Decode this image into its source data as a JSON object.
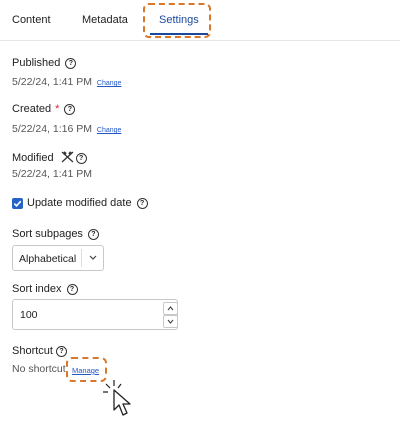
{
  "tabs": {
    "content": "Content",
    "metadata": "Metadata",
    "settings": "Settings"
  },
  "published": {
    "label": "Published",
    "value": "5/22/24, 1:41 PM",
    "action": "Change"
  },
  "created": {
    "label": "Created",
    "required_mark": "*",
    "value": "5/22/24, 1:16 PM",
    "action": "Change"
  },
  "modified": {
    "label": "Modified",
    "value": "5/22/24, 1:41 PM"
  },
  "update_modified": {
    "label": "Update modified date",
    "checked": true
  },
  "sort_subpages": {
    "label": "Sort subpages",
    "selected": "Alphabetical"
  },
  "sort_index": {
    "label": "Sort index",
    "value": "100"
  },
  "shortcut": {
    "label": "Shortcut",
    "value": "No shortcut",
    "action": "Manage"
  },
  "colors": {
    "accent": "#1a4a9e",
    "link": "#2458c8",
    "checkbox": "#2563c7",
    "highlight": "#d9782b",
    "required": "#dd2233"
  },
  "icons": {
    "help": "help-circle-icon",
    "modified_disabled": "tools-crossed-icon",
    "checkbox": "check-icon",
    "select": "chevron-down-icon",
    "spin_up": "chevron-up-icon",
    "spin_down": "chevron-down-icon",
    "cursor": "pointer-cursor-icon"
  }
}
